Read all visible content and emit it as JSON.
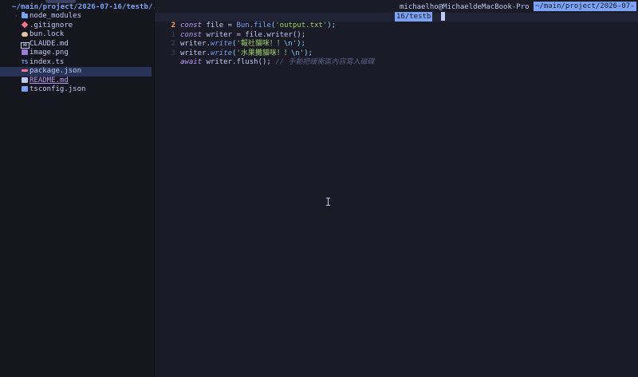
{
  "explorer": {
    "path": "~/main/project/2026-07-16/testb/.",
    "items": [
      {
        "name": "node_modules",
        "icon": "folder-icon",
        "chevron": "›"
      },
      {
        "name": ".gitignore",
        "icon": "git-icon"
      },
      {
        "name": "bun.lock",
        "icon": "bun-icon"
      },
      {
        "name": "CLAUDE.md",
        "icon": "markdown-icon",
        "badge": "MD"
      },
      {
        "name": "image.png",
        "icon": "image-icon"
      },
      {
        "name": "index.ts",
        "icon": "typescript-icon",
        "badge": "TS"
      },
      {
        "name": "package.json",
        "icon": "json-icon"
      },
      {
        "name": "README.md",
        "icon": "readme-icon"
      },
      {
        "name": "tsconfig.json",
        "icon": "tsconfig-icon"
      }
    ]
  },
  "editor": {
    "line_numbers": [
      "1",
      "2",
      "1",
      "2",
      "3"
    ],
    "lines": {
      "l1": {
        "kw": "const",
        "a": " file = ",
        "fn": "Bun.file",
        "b": "(",
        "str": "'output.txt'",
        "c": ");"
      },
      "l2": {
        "kw": "const",
        "a": " writer = file.writer();"
      },
      "l3": {
        "a": "writer.",
        "meth": "write",
        "b": "(",
        "str": "'報社貓咪！！",
        "esc": "\\n",
        "str2": "'",
        "c": ");"
      },
      "l4": {
        "a": "writer.",
        "meth": "write",
        "b": "(",
        "str": "'水果攤貓咪！！",
        "esc": "\\n",
        "str2": "'",
        "c": ");"
      },
      "l5": {
        "kw": "await",
        "a": " writer.flush(); ",
        "cmt": "// 手動把緩衝區內容寫入磁碟"
      }
    }
  },
  "terminal": {
    "user": "michaelho@MichaeldeMacBook-Pro",
    "path_part1": "~/main/project/2026-07-",
    "path_part2": "16/testb"
  },
  "colors": {
    "background": "#1a1b26",
    "sidebar": "#16161e",
    "accent": "#7aa2f7",
    "keyword": "#bb9af7",
    "string": "#9ece6a",
    "comment": "#565f89",
    "current_line_number": "#ff9e64"
  }
}
